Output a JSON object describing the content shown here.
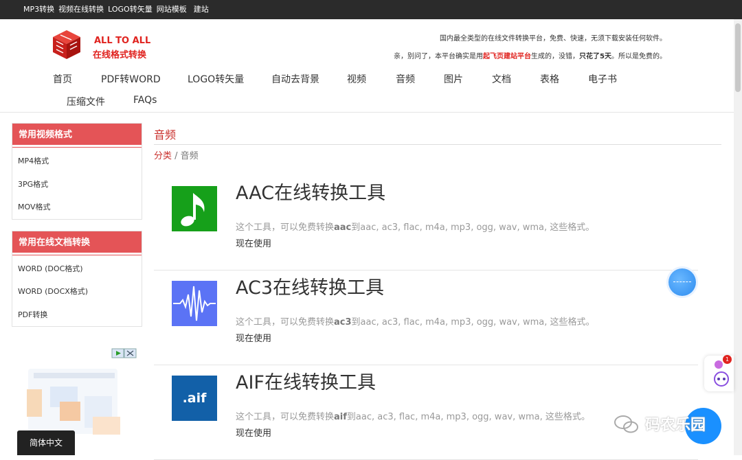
{
  "topbar": {
    "links": [
      "MP3转换",
      "视频在线转换",
      "LOGO转矢量",
      "网站模板",
      "建站"
    ]
  },
  "header": {
    "logo_line1": "ALL TO ALL",
    "logo_line2": "在线格式转换",
    "tagline1": "国内最全类型的在线文件转换平台，免费、快速，无须下载安装任何软件。",
    "tagline2_pre": "亲，别问了，本平台确实是用",
    "tagline2_red": "起飞页建站平台",
    "tagline2_mid": "生成的，没错，",
    "tagline2_bold": "只花了5天",
    "tagline2_post": "。所以是免费的。"
  },
  "nav": [
    "首页",
    "PDF转WORD",
    "LOGO转矢量",
    "自动去背景",
    "视频",
    "音频",
    "图片",
    "文档",
    "表格",
    "电子书",
    "压缩文件",
    "FAQs"
  ],
  "sidebar": {
    "video": {
      "title": "常用视频格式",
      "items": [
        "MP4格式",
        "3PG格式",
        "MOV格式"
      ]
    },
    "docs": {
      "title": "常用在线文档转换",
      "items": [
        "WORD (DOC格式)",
        "WORD (DOCX格式)",
        "PDF转换"
      ]
    }
  },
  "lang_button": "简体中文",
  "main": {
    "title": "音频",
    "crumb_link": "分类",
    "crumb_sep": " / ",
    "crumb_current": "音频",
    "tools": [
      {
        "name": "AAC在线转换工具",
        "desc_pre": "这个工具，可以免费转换",
        "fmt": "aac",
        "desc_post": "到aac, ac3, flac, m4a, mp3, ogg, wav, wma, 这些格式。",
        "use": "现在使用",
        "icon": "music-note-icon",
        "color": "#16a01a"
      },
      {
        "name": "AC3在线转换工具",
        "desc_pre": "这个工具，可以免费转换",
        "fmt": "ac3",
        "desc_post": "到aac, ac3, flac, m4a, mp3, ogg, wav, wma, 这些格式。",
        "use": "现在使用",
        "icon": "waveform-icon",
        "color": "#5b73f5"
      },
      {
        "name": "AIF在线转换工具",
        "desc_pre": "这个工具，可以免费转换",
        "fmt": "aif",
        "desc_post": "到aac, ac3, flac, m4a, mp3, ogg, wav, wma, 这些格式。",
        "use": "现在使用",
        "icon": "aif-file-icon",
        "color": "#1260a8",
        "icon_text": ".aif"
      }
    ]
  },
  "float": {
    "badge_count": "1"
  },
  "watermark": {
    "text": "码农乐园"
  }
}
